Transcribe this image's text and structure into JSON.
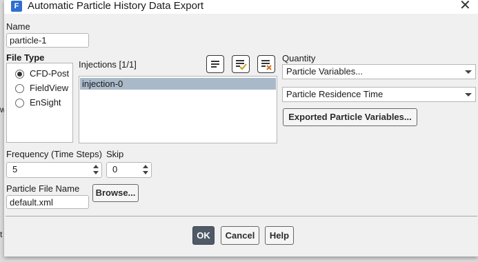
{
  "window": {
    "title": "Automatic Particle History Data Export",
    "icon_letter": "F",
    "close_glyph": "✕"
  },
  "name": {
    "label": "Name",
    "value": "particle-1"
  },
  "file_type": {
    "label": "File Type",
    "options": [
      {
        "label": "CFD-Post",
        "selected": true
      },
      {
        "label": "FieldView",
        "selected": false
      },
      {
        "label": "EnSight",
        "selected": false
      }
    ]
  },
  "injections": {
    "label": "Injections [1/1]",
    "items": [
      "injection-0"
    ]
  },
  "quantity": {
    "label": "Quantity",
    "type_value": "Particle Variables...",
    "variable_value": "Particle Residence Time",
    "exported_button": "Exported Particle Variables..."
  },
  "frequency": {
    "label": "Frequency (Time Steps)",
    "value": "5"
  },
  "skip": {
    "label": "Skip",
    "value": "0"
  },
  "particle_file": {
    "label": "Particle File Name",
    "value": "default.xml",
    "browse_label": "Browse..."
  },
  "buttons": {
    "ok": "OK",
    "cancel": "Cancel",
    "help": "Help"
  },
  "background": {
    "fragment_w": "w",
    "fragment_t": "t"
  },
  "colors": {
    "primary_button": "#505a66",
    "selection": "#a9b9c9",
    "accent_icon": "#c8a020",
    "clear_icon": "#d07020"
  }
}
